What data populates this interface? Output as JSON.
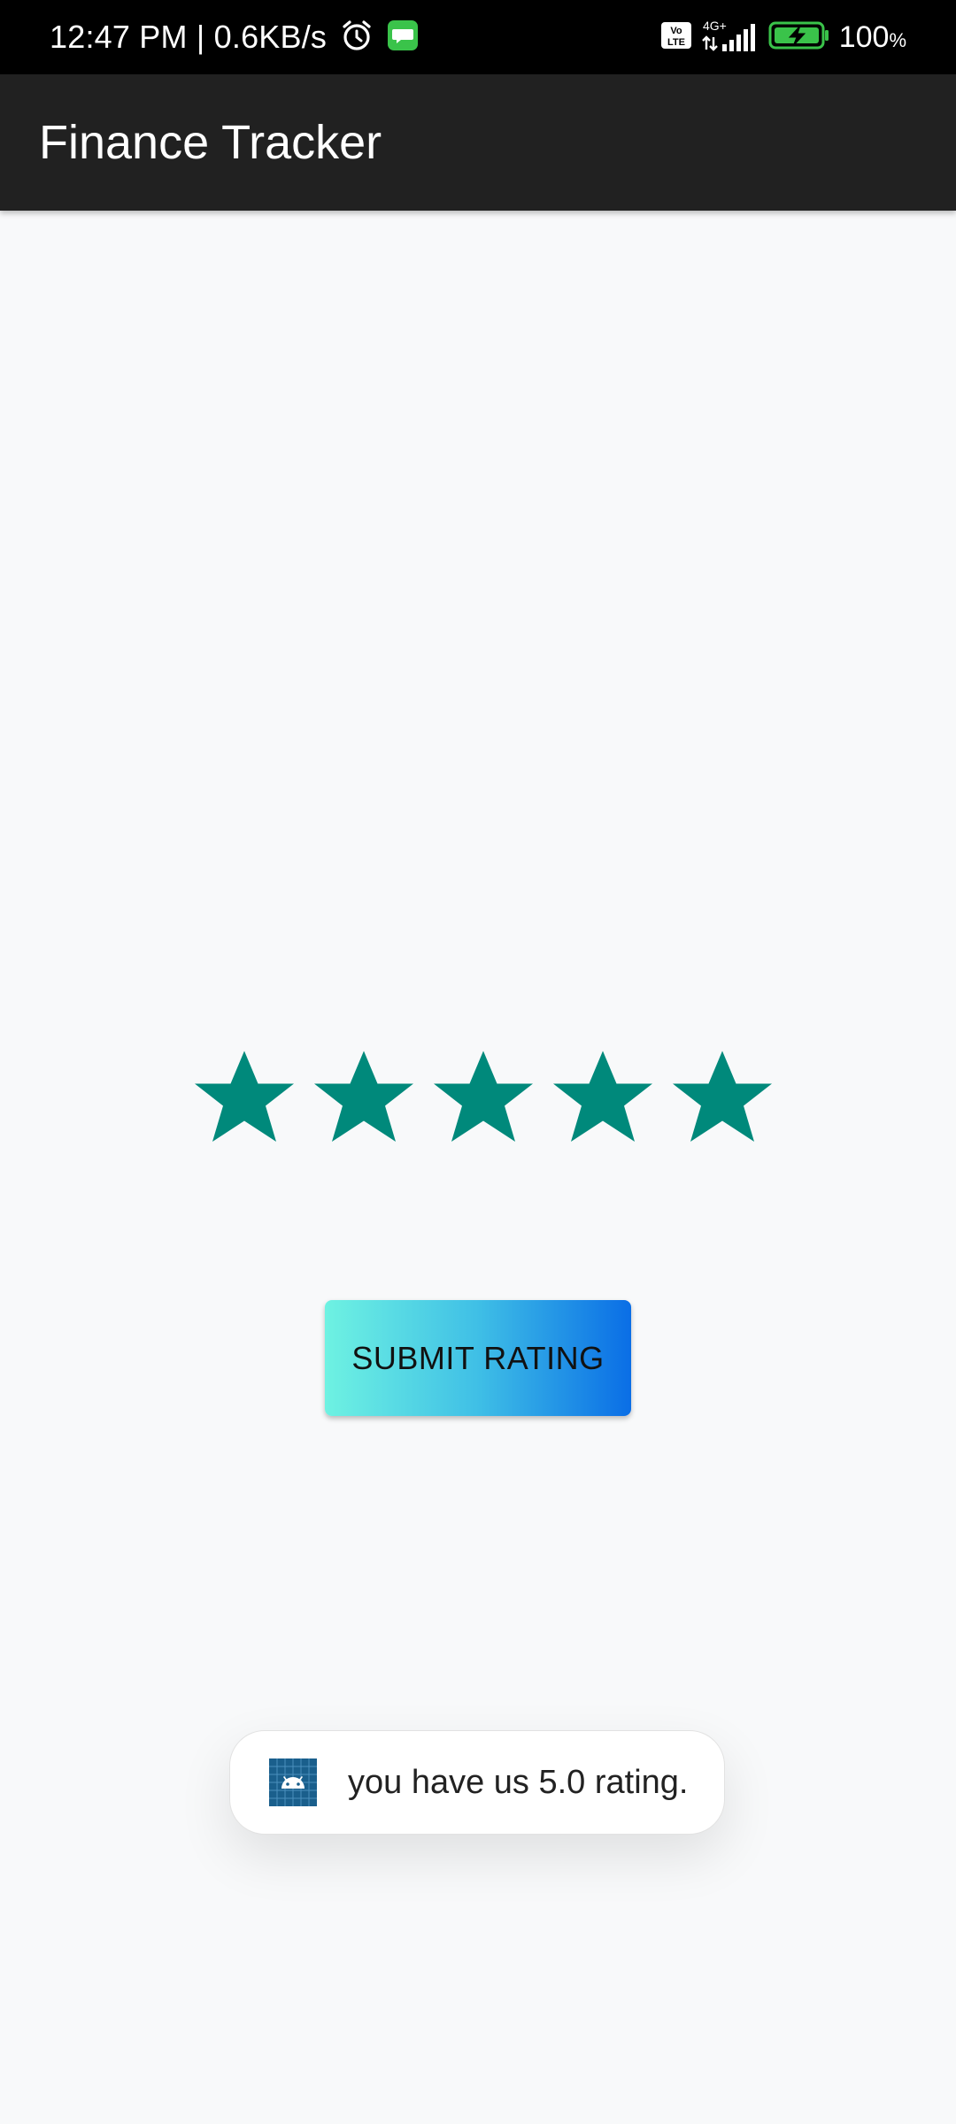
{
  "status_bar": {
    "time": "12:47 PM | 0.6KB/s",
    "network_label": "4G+",
    "volte_label": "Vo LTE",
    "battery": "100",
    "battery_unit": "%"
  },
  "app_bar": {
    "title": "Finance Tracker"
  },
  "rating": {
    "value": 5,
    "max": 5,
    "star_color": "#00897b"
  },
  "submit_button": {
    "label": "SUBMIT RATING"
  },
  "toast": {
    "message": "you have us 5.0 rating.",
    "icon": "android-app-icon"
  }
}
